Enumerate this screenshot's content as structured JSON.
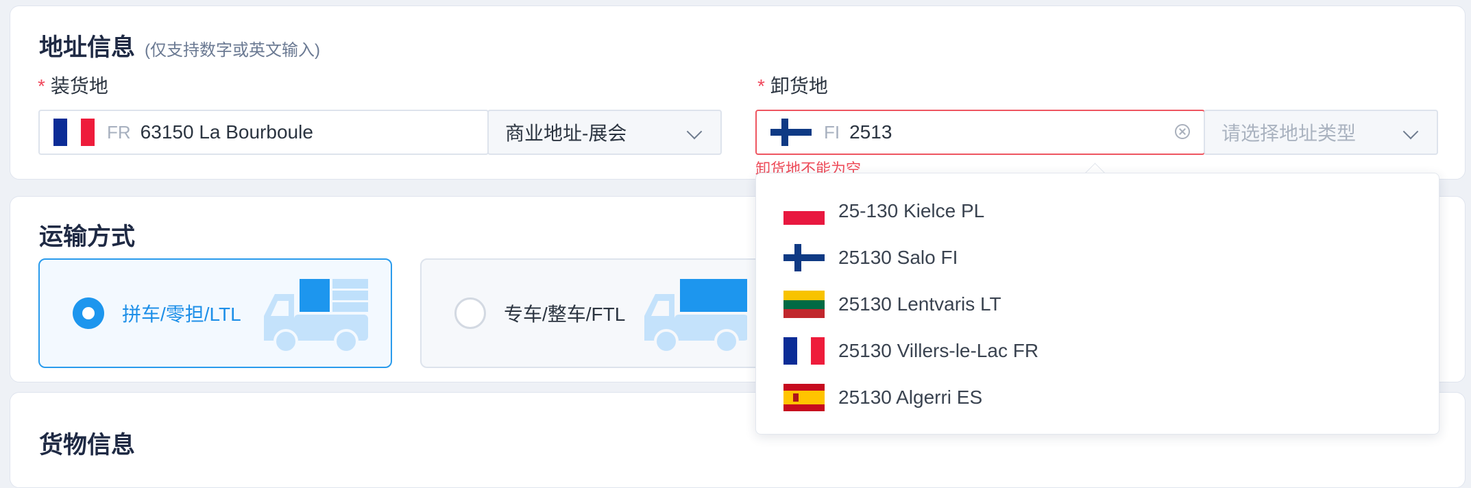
{
  "address_section": {
    "title": "地址信息",
    "note": "(仅支持数字或英文输入)",
    "required_mark": "*",
    "pickup": {
      "label": "装货地",
      "flag_icon": "flag-fr-icon",
      "country_code": "FR",
      "value": "63150 La Bourboule",
      "type_value": "商业地址-展会"
    },
    "delivery": {
      "label": "卸货地",
      "flag_icon": "flag-fi-icon",
      "country_code": "FI",
      "value": "2513",
      "type_placeholder": "请选择地址类型",
      "error": "卸货地不能为空"
    }
  },
  "transport_section": {
    "title": "运输方式",
    "options": [
      {
        "label": "拼车/零担/LTL",
        "selected": true
      },
      {
        "label": "专车/整车/FTL",
        "selected": false
      }
    ]
  },
  "cargo_section": {
    "title": "货物信息"
  },
  "suggestions": [
    {
      "text": "25-130 Kielce PL",
      "flag": "flag-pl-icon"
    },
    {
      "text": "25130 Salo FI",
      "flag": "flag-fi-icon"
    },
    {
      "text": "25130 Lentvaris LT",
      "flag": "flag-lt-icon"
    },
    {
      "text": "25130 Villers-le-Lac FR",
      "flag": "flag-fr-icon"
    },
    {
      "text": "25130 Algerri ES",
      "flag": "flag-es-icon"
    }
  ],
  "colors": {
    "accent": "#1d96ee",
    "error": "#ee4c5a",
    "page_bg": "#eef1f6"
  }
}
